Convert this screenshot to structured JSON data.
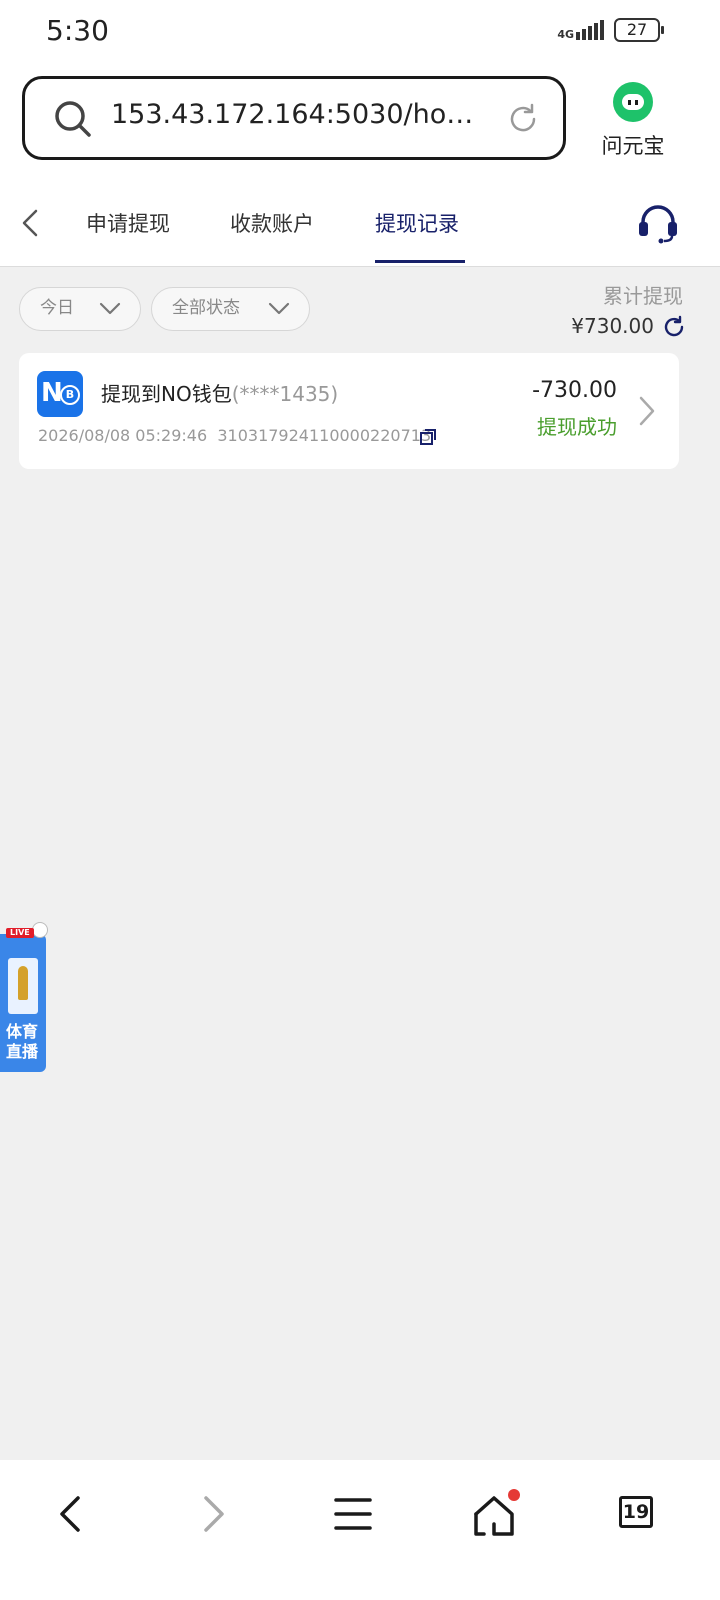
{
  "status_bar": {
    "time": "5:30",
    "network": "4G",
    "battery": "27"
  },
  "browser": {
    "url": "153.43.172.164:5030/home...",
    "assistant_label": "问元宝",
    "icons": [
      "search-icon",
      "reload-icon",
      "assistant-logo"
    ]
  },
  "tabs": {
    "items": [
      {
        "label": "申请提现",
        "active": false
      },
      {
        "label": "收款账户",
        "active": false
      },
      {
        "label": "提现记录",
        "active": true
      }
    ],
    "active_color": "#18216a"
  },
  "filters": {
    "date": "今日",
    "status": "全部状态"
  },
  "summary": {
    "label": "累计提现",
    "amount": "¥730.00"
  },
  "records": [
    {
      "logo_text": "N",
      "logo_coin": "B",
      "title": "提现到NO钱包",
      "account_mask": "(****1435)",
      "datetime": "2026/08/08 05:29:46",
      "order_no": "310317924110000220713",
      "amount": "-730.00",
      "status": "提现成功",
      "status_color": "#4a9e2d"
    }
  ],
  "live_widget": {
    "badge": "LIVE",
    "label": "体育直播"
  },
  "bottom_nav": {
    "items": [
      "back-icon",
      "forward-icon",
      "menu-icon",
      "home-icon",
      "tabs-icon"
    ],
    "tab_count": "19"
  }
}
